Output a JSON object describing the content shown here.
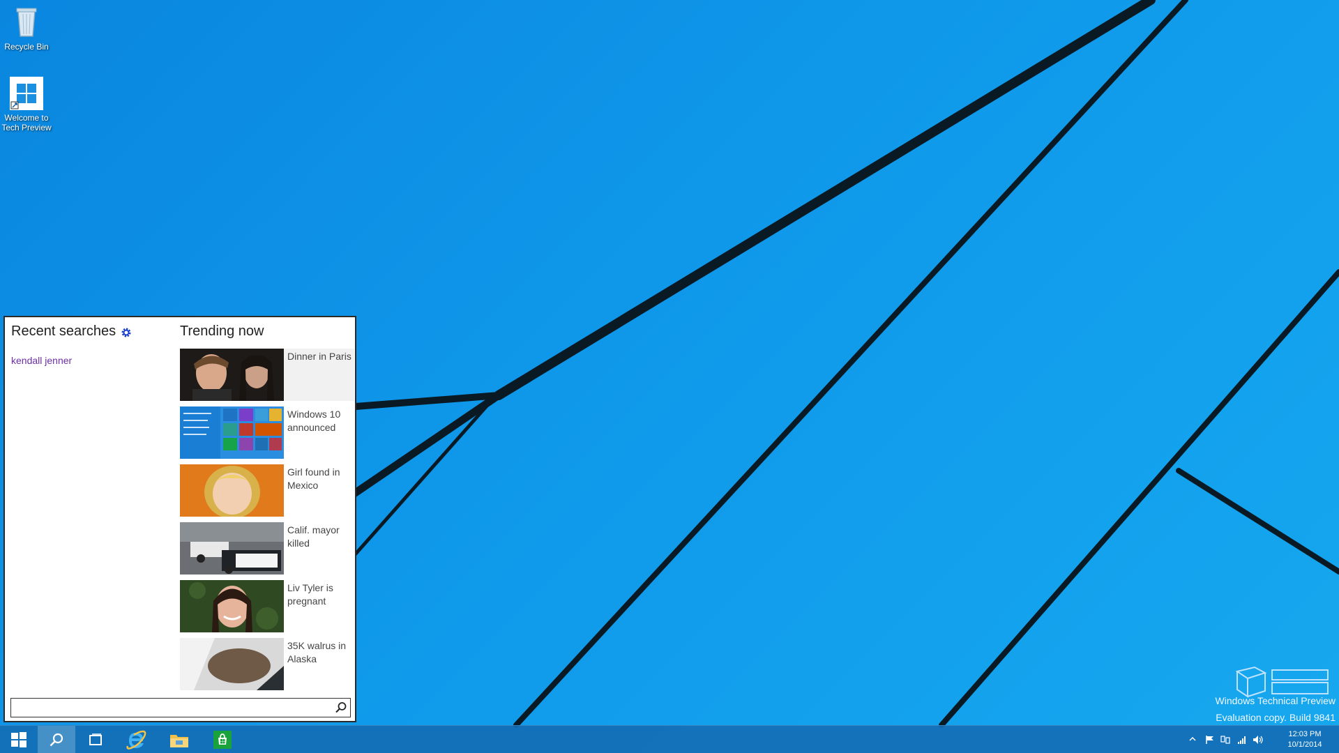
{
  "desktop": {
    "icons": [
      {
        "label": "Recycle Bin"
      },
      {
        "label_line1": "Welcome to",
        "label_line2": "Tech Preview"
      }
    ]
  },
  "search_panel": {
    "recent_heading": "Recent searches",
    "recent_items": [
      "kendall jenner"
    ],
    "trending_heading": "Trending now",
    "trending": [
      {
        "label": "Dinner in Paris"
      },
      {
        "label": "Windows 10 announced"
      },
      {
        "label": "Girl found in Mexico"
      },
      {
        "label": "Calif. mayor killed"
      },
      {
        "label": "Liv Tyler is pregnant"
      },
      {
        "label": "35K walrus in Alaska"
      }
    ],
    "search_input": {
      "value": "",
      "placeholder": ""
    }
  },
  "watermark": {
    "line1": "Windows Technical Preview",
    "line2": "Evaluation copy. Build 9841"
  },
  "taskbar": {
    "clock_time": "12:03 PM",
    "clock_date": "10/1/2014"
  },
  "colors": {
    "accent": "#0f98ea",
    "taskbar": "#146eb4",
    "link": "#6b2ea6"
  }
}
